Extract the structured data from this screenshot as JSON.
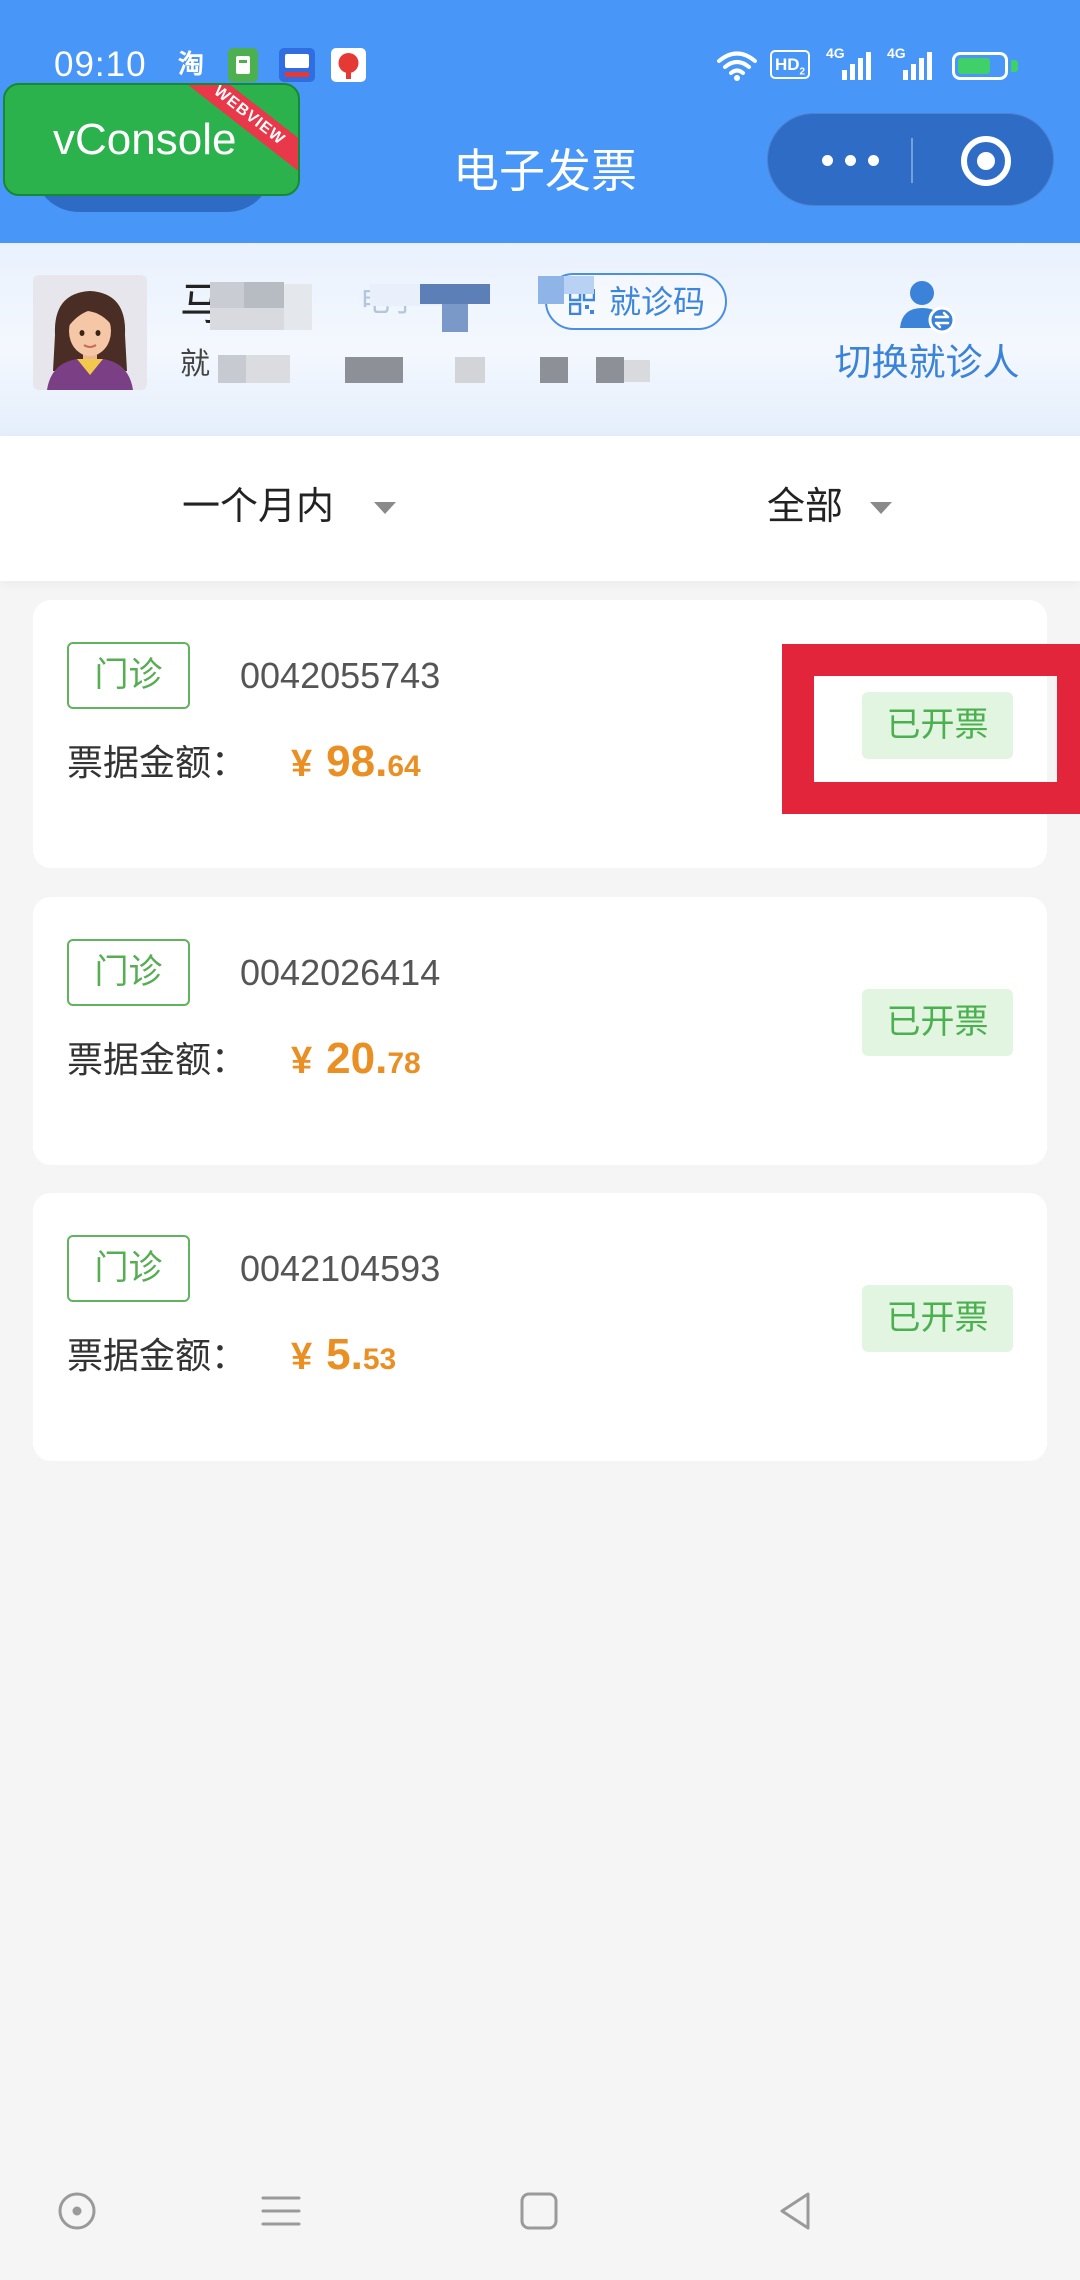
{
  "status_bar": {
    "time": "09:10",
    "app_glyph": "淘",
    "hd_label": "HD",
    "hd_sub": "2",
    "signal_1_label": "4G",
    "signal_2_label": "4G",
    "icons": [
      "taobao-icon",
      "app-green-icon",
      "app-blue-icon",
      "app-red-icon",
      "wifi-icon",
      "hd-voice-icon",
      "signal-icon",
      "battery-icon"
    ]
  },
  "vconsole": {
    "label": "vConsole",
    "ribbon": "WEBVIEW"
  },
  "nav": {
    "title": "电子发票",
    "capsule_icons": [
      "more-dots-icon",
      "target-close-icon"
    ]
  },
  "patient": {
    "name": "马",
    "card_label": "电子",
    "id_prefix": "就",
    "qr_button": "就诊码",
    "switch_button": "切换就诊人",
    "avatar": "female-avatar"
  },
  "filters": {
    "period": "一个月内",
    "category": "全部"
  },
  "invoices": [
    {
      "type": "门诊",
      "number": "0042055743",
      "amount_label": "票据金额：",
      "currency": "¥",
      "amount_int": "98.",
      "amount_dec": "64",
      "status": "已开票"
    },
    {
      "type": "门诊",
      "number": "0042026414",
      "amount_label": "票据金额：",
      "currency": "¥",
      "amount_int": "20.",
      "amount_dec": "78",
      "status": "已开票"
    },
    {
      "type": "门诊",
      "number": "0042104593",
      "amount_label": "票据金额：",
      "currency": "¥",
      "amount_int": "5.",
      "amount_dec": "53",
      "status": "已开票"
    }
  ],
  "system_nav_icons": [
    "circle-icon",
    "menu-icon",
    "square-icon",
    "back-triangle-icon"
  ],
  "colors": {
    "header": "#4796f8",
    "vconsole": "#2bb24c",
    "accent_blue": "#3b82d9",
    "outpatient_green": "#56ad52",
    "status_bg": "#e2f5e1",
    "amount_orange": "#ea8f23",
    "highlight_red": "#e3253c"
  }
}
